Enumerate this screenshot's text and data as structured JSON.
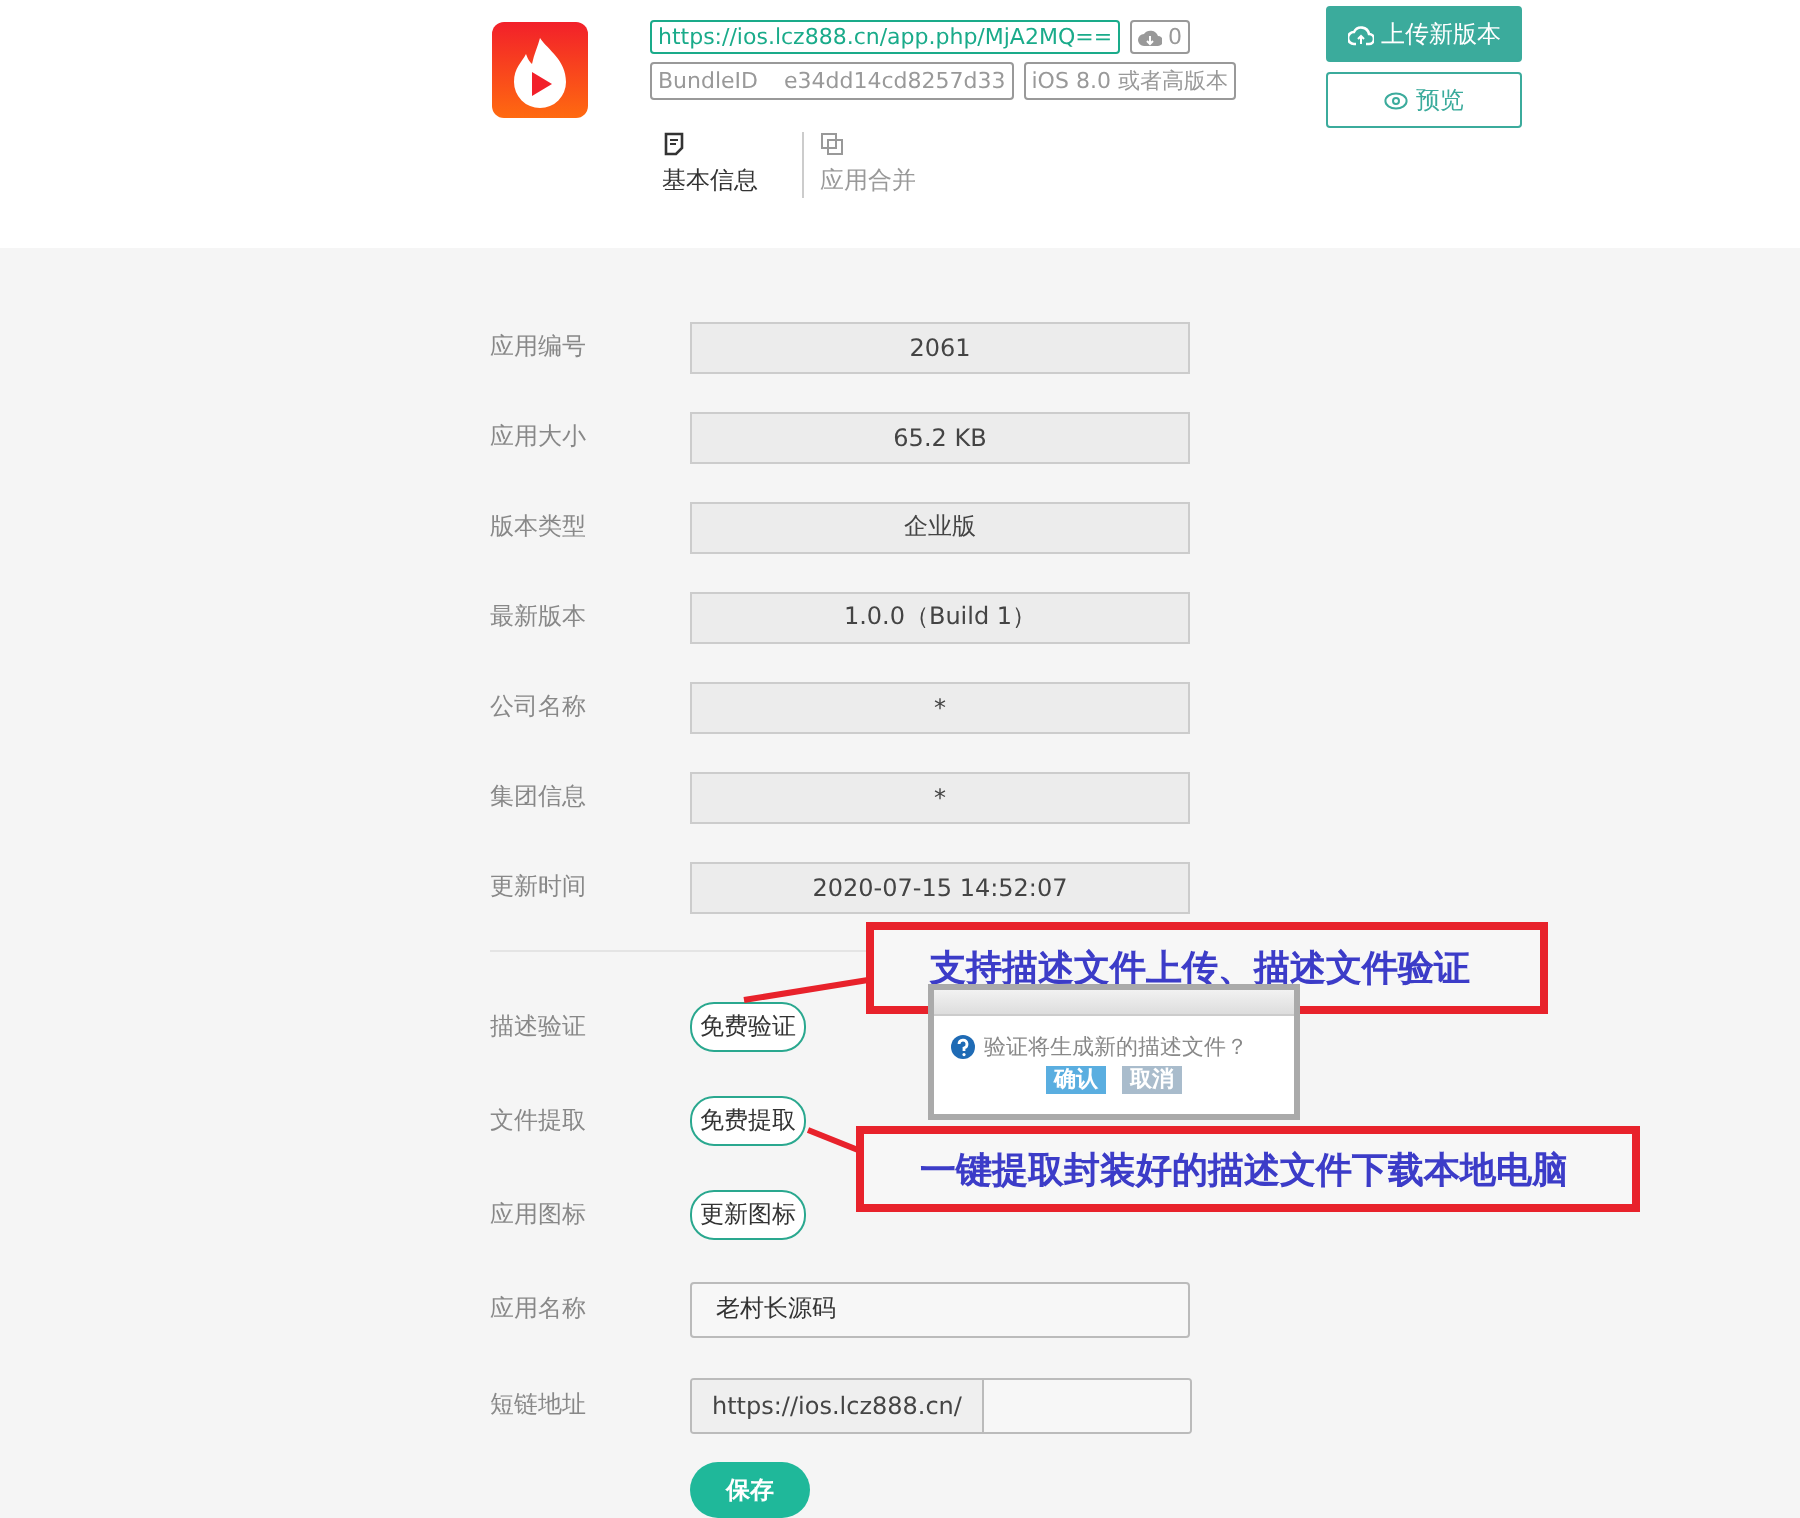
{
  "header": {
    "url": "https://ios.lcz888.cn/app.php/MjA2MQ==",
    "downloads": "0",
    "bundle_id_label": "BundleID",
    "bundle_id": "e34dd14cd8257d33",
    "requirement": "iOS 8.0 或者高版本",
    "upload_button": "上传新版本",
    "preview_button": "预览"
  },
  "tabs": [
    {
      "label": "基本信息",
      "kind": "info",
      "selected": true
    },
    {
      "label": "应用合并",
      "kind": "merge",
      "selected": false
    }
  ],
  "info_rows": [
    {
      "label": "应用编号",
      "value": "2061"
    },
    {
      "label": "应用大小",
      "value": "65.2 KB"
    },
    {
      "label": "版本类型",
      "value": "企业版"
    },
    {
      "label": "最新版本",
      "value": "1.0.0（Build 1）"
    },
    {
      "label": "公司名称",
      "value": "*"
    },
    {
      "label": "集团信息",
      "value": "*"
    },
    {
      "label": "更新时间",
      "value": "2020-07-15 14:52:07"
    }
  ],
  "action_rows": [
    {
      "label": "描述验证",
      "button": "免费验证"
    },
    {
      "label": "文件提取",
      "button": "免费提取"
    },
    {
      "label": "应用图标",
      "button": "更新图标"
    }
  ],
  "app_name": {
    "label": "应用名称",
    "value": "老村长源码"
  },
  "short_link": {
    "label": "短链地址",
    "prefix": "https://ios.lcz888.cn/"
  },
  "save_button": "保存",
  "dialog": {
    "message": "验证将生成新的描述文件？",
    "confirm": "确认",
    "cancel": "取消"
  },
  "annotations": [
    "支持描述文件上传、描述文件验证",
    "一键提取封装好的描述文件下载本地电脑"
  ]
}
